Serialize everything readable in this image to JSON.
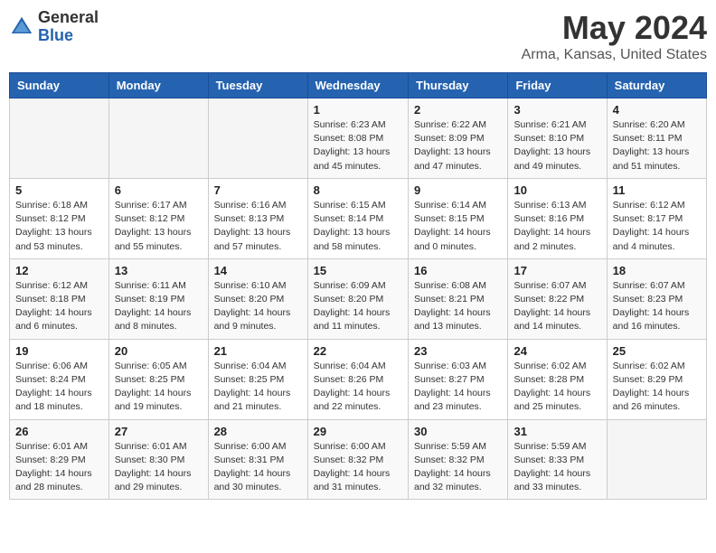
{
  "header": {
    "logo_line1": "General",
    "logo_line2": "Blue",
    "month_title": "May 2024",
    "location": "Arma, Kansas, United States"
  },
  "days_of_week": [
    "Sunday",
    "Monday",
    "Tuesday",
    "Wednesday",
    "Thursday",
    "Friday",
    "Saturday"
  ],
  "weeks": [
    [
      {
        "day": "",
        "info": ""
      },
      {
        "day": "",
        "info": ""
      },
      {
        "day": "",
        "info": ""
      },
      {
        "day": "1",
        "info": "Sunrise: 6:23 AM\nSunset: 8:08 PM\nDaylight: 13 hours\nand 45 minutes."
      },
      {
        "day": "2",
        "info": "Sunrise: 6:22 AM\nSunset: 8:09 PM\nDaylight: 13 hours\nand 47 minutes."
      },
      {
        "day": "3",
        "info": "Sunrise: 6:21 AM\nSunset: 8:10 PM\nDaylight: 13 hours\nand 49 minutes."
      },
      {
        "day": "4",
        "info": "Sunrise: 6:20 AM\nSunset: 8:11 PM\nDaylight: 13 hours\nand 51 minutes."
      }
    ],
    [
      {
        "day": "5",
        "info": "Sunrise: 6:18 AM\nSunset: 8:12 PM\nDaylight: 13 hours\nand 53 minutes."
      },
      {
        "day": "6",
        "info": "Sunrise: 6:17 AM\nSunset: 8:12 PM\nDaylight: 13 hours\nand 55 minutes."
      },
      {
        "day": "7",
        "info": "Sunrise: 6:16 AM\nSunset: 8:13 PM\nDaylight: 13 hours\nand 57 minutes."
      },
      {
        "day": "8",
        "info": "Sunrise: 6:15 AM\nSunset: 8:14 PM\nDaylight: 13 hours\nand 58 minutes."
      },
      {
        "day": "9",
        "info": "Sunrise: 6:14 AM\nSunset: 8:15 PM\nDaylight: 14 hours\nand 0 minutes."
      },
      {
        "day": "10",
        "info": "Sunrise: 6:13 AM\nSunset: 8:16 PM\nDaylight: 14 hours\nand 2 minutes."
      },
      {
        "day": "11",
        "info": "Sunrise: 6:12 AM\nSunset: 8:17 PM\nDaylight: 14 hours\nand 4 minutes."
      }
    ],
    [
      {
        "day": "12",
        "info": "Sunrise: 6:12 AM\nSunset: 8:18 PM\nDaylight: 14 hours\nand 6 minutes."
      },
      {
        "day": "13",
        "info": "Sunrise: 6:11 AM\nSunset: 8:19 PM\nDaylight: 14 hours\nand 8 minutes."
      },
      {
        "day": "14",
        "info": "Sunrise: 6:10 AM\nSunset: 8:20 PM\nDaylight: 14 hours\nand 9 minutes."
      },
      {
        "day": "15",
        "info": "Sunrise: 6:09 AM\nSunset: 8:20 PM\nDaylight: 14 hours\nand 11 minutes."
      },
      {
        "day": "16",
        "info": "Sunrise: 6:08 AM\nSunset: 8:21 PM\nDaylight: 14 hours\nand 13 minutes."
      },
      {
        "day": "17",
        "info": "Sunrise: 6:07 AM\nSunset: 8:22 PM\nDaylight: 14 hours\nand 14 minutes."
      },
      {
        "day": "18",
        "info": "Sunrise: 6:07 AM\nSunset: 8:23 PM\nDaylight: 14 hours\nand 16 minutes."
      }
    ],
    [
      {
        "day": "19",
        "info": "Sunrise: 6:06 AM\nSunset: 8:24 PM\nDaylight: 14 hours\nand 18 minutes."
      },
      {
        "day": "20",
        "info": "Sunrise: 6:05 AM\nSunset: 8:25 PM\nDaylight: 14 hours\nand 19 minutes."
      },
      {
        "day": "21",
        "info": "Sunrise: 6:04 AM\nSunset: 8:25 PM\nDaylight: 14 hours\nand 21 minutes."
      },
      {
        "day": "22",
        "info": "Sunrise: 6:04 AM\nSunset: 8:26 PM\nDaylight: 14 hours\nand 22 minutes."
      },
      {
        "day": "23",
        "info": "Sunrise: 6:03 AM\nSunset: 8:27 PM\nDaylight: 14 hours\nand 23 minutes."
      },
      {
        "day": "24",
        "info": "Sunrise: 6:02 AM\nSunset: 8:28 PM\nDaylight: 14 hours\nand 25 minutes."
      },
      {
        "day": "25",
        "info": "Sunrise: 6:02 AM\nSunset: 8:29 PM\nDaylight: 14 hours\nand 26 minutes."
      }
    ],
    [
      {
        "day": "26",
        "info": "Sunrise: 6:01 AM\nSunset: 8:29 PM\nDaylight: 14 hours\nand 28 minutes."
      },
      {
        "day": "27",
        "info": "Sunrise: 6:01 AM\nSunset: 8:30 PM\nDaylight: 14 hours\nand 29 minutes."
      },
      {
        "day": "28",
        "info": "Sunrise: 6:00 AM\nSunset: 8:31 PM\nDaylight: 14 hours\nand 30 minutes."
      },
      {
        "day": "29",
        "info": "Sunrise: 6:00 AM\nSunset: 8:32 PM\nDaylight: 14 hours\nand 31 minutes."
      },
      {
        "day": "30",
        "info": "Sunrise: 5:59 AM\nSunset: 8:32 PM\nDaylight: 14 hours\nand 32 minutes."
      },
      {
        "day": "31",
        "info": "Sunrise: 5:59 AM\nSunset: 8:33 PM\nDaylight: 14 hours\nand 33 minutes."
      },
      {
        "day": "",
        "info": ""
      }
    ]
  ]
}
